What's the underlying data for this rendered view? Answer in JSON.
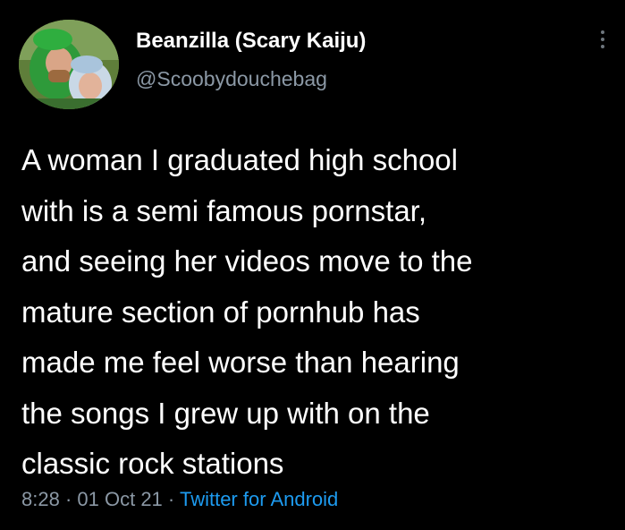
{
  "tweet": {
    "author": {
      "display_name": "Beanzilla (Scary Kaiju)",
      "handle": "@Scoobydouchebag",
      "avatar_icon": "profile-photo"
    },
    "more_icon": "more-vertical-icon",
    "text": "A woman I graduated high school\nwith is a semi famous pornstar,\nand seeing her videos move to the\nmature section of pornhub has\nmade me feel worse than hearing\nthe songs I grew up with on the\nclassic rock stations",
    "time": "8:28",
    "separator": "·",
    "date": "01 Oct 21",
    "source": "Twitter for Android"
  },
  "colors": {
    "background": "#000000",
    "name": "#ffffff",
    "secondary": "#8b98a5",
    "link": "#1d9bf0"
  }
}
